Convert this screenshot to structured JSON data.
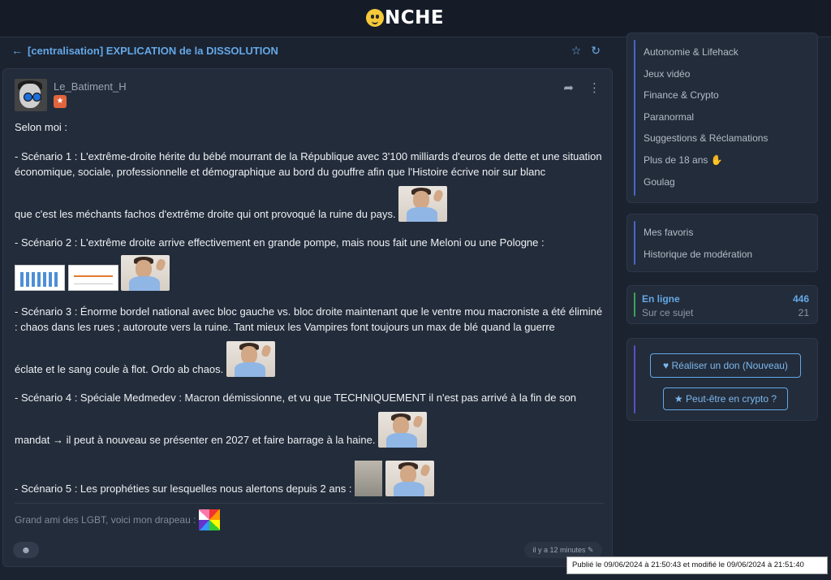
{
  "site": {
    "logo_text": "NCHE"
  },
  "topic": {
    "title": "[centralisation] EXPLICATION de la DISSOLUTION"
  },
  "post": {
    "author": "Le_Batiment_H",
    "body": {
      "intro": "Selon moi :",
      "s1a": "- Scénario 1 : L'extrême-droite hérite du bébé mourrant de la République avec 3'100 milliards d'euros de dette et une situation économique, sociale, professionnelle et démographique au bord du gouffre afin que l'Histoire écrive noir sur blanc",
      "s1b": "que c'est les méchants fachos d'extrême droite qui ont provoqué la ruine du pays.",
      "s2": "- Scénario 2 : L'extrême droite arrive effectivement en grande pompe, mais nous fait une Meloni ou une Pologne :",
      "s3a": "- Scénario 3 : Énorme bordel national avec bloc gauche vs. bloc droite maintenant que le ventre mou macroniste a été éliminé : chaos dans les rues ; autoroute vers la ruine. Tant mieux les Vampires font toujours un max de blé quand la guerre",
      "s3b": "éclate et le sang coule à flot. Ordo ab chaos.",
      "s4a": "- Scénario 4 : Spéciale Medmedev : Macron démissionne, et vu que TECHNIQUEMENT il n'est pas arrivé à la fin de son",
      "s4b": "mandat → il peut à nouveau se présenter en 2027 et faire barrage à la haine.",
      "s5": "- Scénario 5 : Les prophéties sur lesquelles nous alertons depuis 2 ans :"
    },
    "signature": "Grand ami des LGBT, voici mon drapeau :",
    "time_ago": "il y a 12 minutes",
    "tooltip": "Publié le 09/06/2024 à 21:50:43 et modifié le 09/06/2024 à 21:51:40"
  },
  "sidebar": {
    "categories": [
      "Autonomie & Lifehack",
      "Jeux vidéo",
      "Finance & Crypto",
      "Paranormal",
      "Suggestions & Réclamations",
      "Plus de 18 ans",
      "Goulag"
    ],
    "user_links": [
      "Mes favoris",
      "Historique de modération"
    ],
    "online": {
      "label": "En ligne",
      "count": "446",
      "topic_label": "Sur ce sujet",
      "topic_count": "21"
    },
    "donate_label": "Réaliser un don (Nouveau)",
    "crypto_label": "Peut-être en crypto ?"
  },
  "colors": {
    "background": "#1b2331",
    "card": "#232c3a",
    "accent": "#64a8e6",
    "online_green": "#3aa35b",
    "donate_purple": "#5a4fc7"
  }
}
